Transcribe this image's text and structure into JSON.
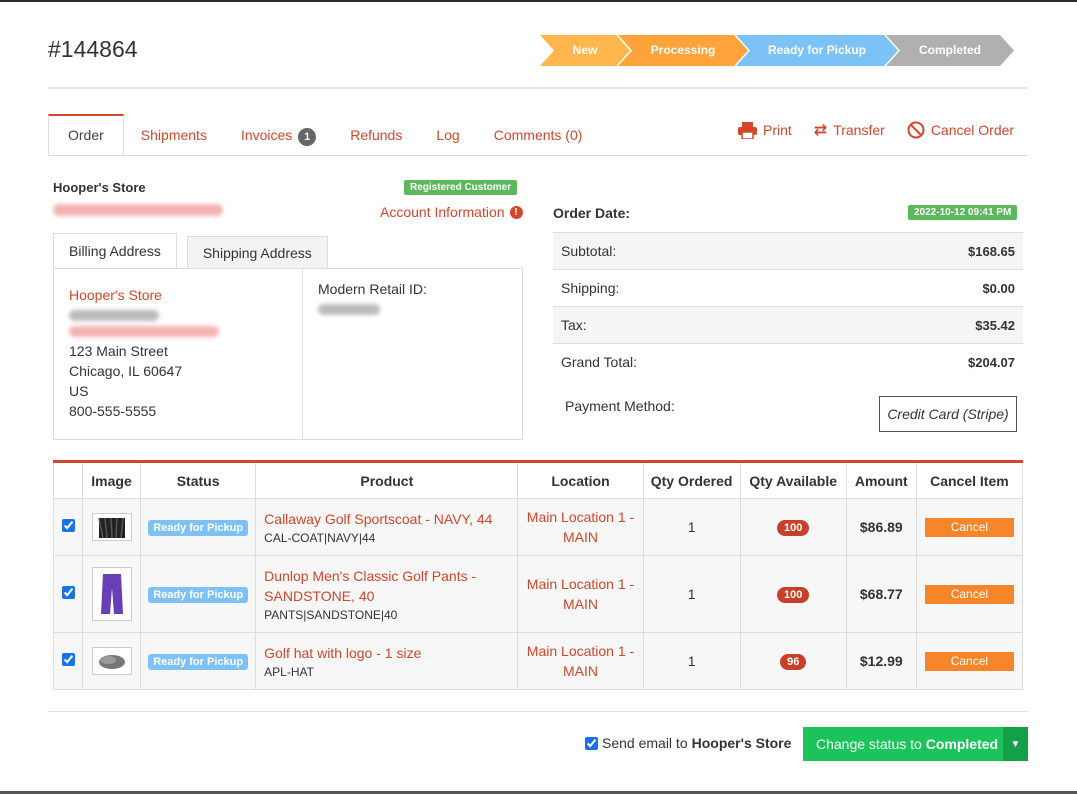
{
  "order": {
    "number": "#144864"
  },
  "progress": {
    "steps": [
      "New",
      "Processing",
      "Ready for Pickup",
      "Completed"
    ],
    "current": "Ready for Pickup"
  },
  "tabs": [
    {
      "label": "Order"
    },
    {
      "label": "Shipments"
    },
    {
      "label": "Invoices",
      "count": "1"
    },
    {
      "label": "Refunds"
    },
    {
      "label": "Log"
    },
    {
      "label": "Comments (0)"
    }
  ],
  "actions": {
    "print": "Print",
    "transfer": "Transfer",
    "cancel": "Cancel Order"
  },
  "customer": {
    "name": "Hooper's Store",
    "badge": "Registered Customer",
    "account_info": "Account Information"
  },
  "address": {
    "tabs": [
      "Billing Address",
      "Shipping Address"
    ],
    "name": "Hooper's Store",
    "street": "123 Main Street",
    "city": "Chicago, IL 60647",
    "country": "US",
    "phone": "800-555-5555",
    "retail_id_label": "Modern Retail ID:"
  },
  "summary": {
    "date_label": "Order Date:",
    "date": "2022-10-12 09:41 PM",
    "rows": [
      {
        "label": "Subtotal:",
        "value": "$168.65"
      },
      {
        "label": "Shipping:",
        "value": "$0.00"
      },
      {
        "label": "Tax:",
        "value": "$35.42"
      },
      {
        "label": "Grand Total:",
        "value": "$204.07"
      }
    ],
    "payment_label": "Payment Method:",
    "payment_value": "Credit Card (Stripe)"
  },
  "items": {
    "headers": [
      "",
      "Image",
      "Status",
      "Product",
      "Location",
      "Qty Ordered",
      "Qty Available",
      "Amount",
      "Cancel Item"
    ],
    "cancel_label": "Cancel",
    "rows": [
      {
        "status": "Ready for Pickup",
        "product": "Callaway Golf Sportscoat - NAVY, 44",
        "sku": "CAL-COAT|NAVY|44",
        "location": "Main Location 1 - MAIN",
        "qty_ordered": "1",
        "qty_available": "100",
        "amount": "$86.89"
      },
      {
        "status": "Ready for Pickup",
        "product": "Dunlop Men's Classic Golf Pants - SANDSTONE, 40",
        "sku": "PANTS|SANDSTONE|40",
        "location": "Main Location 1 - MAIN",
        "qty_ordered": "1",
        "qty_available": "100",
        "amount": "$68.77"
      },
      {
        "status": "Ready for Pickup",
        "product": "Golf hat with logo - 1 size",
        "sku": "APL-HAT",
        "location": "Main Location 1 - MAIN",
        "qty_ordered": "1",
        "qty_available": "96",
        "amount": "$12.99"
      }
    ]
  },
  "footer": {
    "email_prefix": "Send email to",
    "email_target": "Hooper's Store",
    "status_prefix": "Change status to",
    "status_target": "Completed"
  },
  "colors": {
    "accent": "#d2462a",
    "success": "#1bc45a",
    "pickup": "#7cc2f7",
    "cancel": "#f7852a"
  }
}
